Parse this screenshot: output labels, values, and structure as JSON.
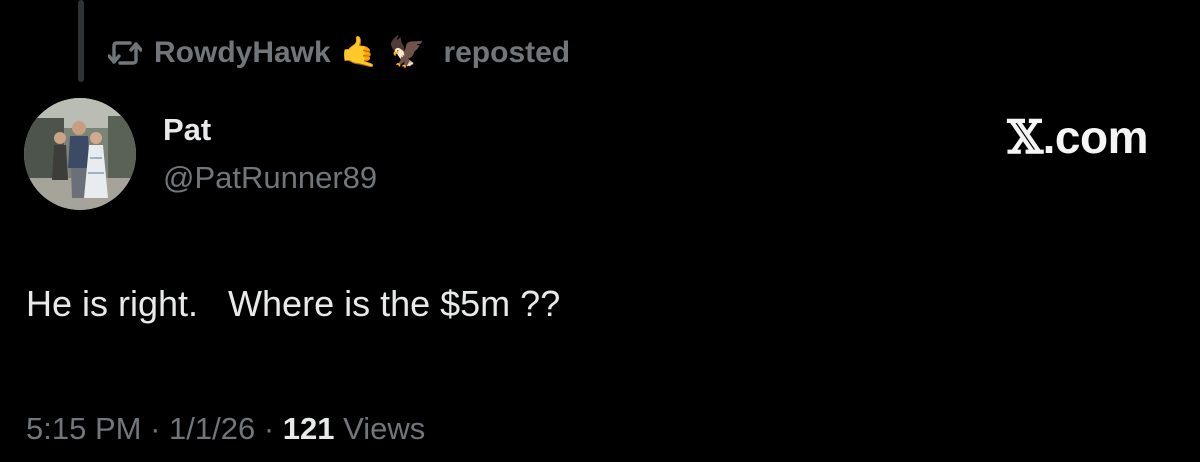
{
  "repost": {
    "icon": "repost-icon",
    "reposter_name": "RowdyHawk",
    "emojis": [
      "🤙",
      "🦅"
    ],
    "label": "reposted"
  },
  "author": {
    "name": "Pat",
    "handle": "@PatRunner89",
    "avatar": "profile-photo-avatar"
  },
  "brand": {
    "x_mark": "𝕏",
    "domain": ".com"
  },
  "tweet": {
    "text": "He is right.   Where is the $5m ??"
  },
  "meta": {
    "time": "5:15 PM",
    "separator": " · ",
    "date": "1/1/26",
    "views_count": "121",
    "views_label": " Views"
  },
  "colors": {
    "background": "#000000",
    "primary_text": "#e7e9ea",
    "secondary_text": "#71767b"
  }
}
